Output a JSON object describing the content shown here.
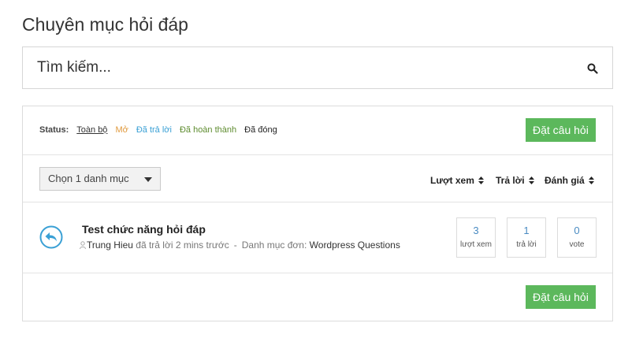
{
  "page": {
    "title": "Chuyên mục hỏi đáp"
  },
  "search": {
    "placeholder": "Tìm kiếm..."
  },
  "status_filter": {
    "label": "Status:",
    "items": [
      {
        "label": "Toàn bộ",
        "state": "active"
      },
      {
        "label": "Mở",
        "state": "open"
      },
      {
        "label": "Đã trả lời",
        "state": "answered"
      },
      {
        "label": "Đã hoàn thành",
        "state": "resolved"
      },
      {
        "label": "Đã đóng",
        "state": "closed"
      }
    ]
  },
  "actions": {
    "ask_label": "Đặt câu hỏi"
  },
  "category_select": {
    "selected": "Chọn 1 danh mục"
  },
  "sort": {
    "views": "Lượt xem",
    "answers": "Trả lời",
    "votes": "Đánh giá"
  },
  "questions": [
    {
      "title": "Test chức năng hỏi đáp",
      "author": "Trung Hieu",
      "activity": "đã trả lời 2 mins trước",
      "separator": "-",
      "category_label": "Danh mục đơn:",
      "category": "Wordpress Questions",
      "views": {
        "count": "3",
        "label": "lượt xem"
      },
      "answers": {
        "count": "1",
        "label": "trả lời"
      },
      "votes": {
        "count": "0",
        "label": "vote"
      }
    }
  ],
  "colors": {
    "accent_green": "#5cb85c",
    "answered_blue": "#3aa0d5",
    "open_orange": "#e09a3e",
    "resolved_green": "#5e8c2f"
  }
}
